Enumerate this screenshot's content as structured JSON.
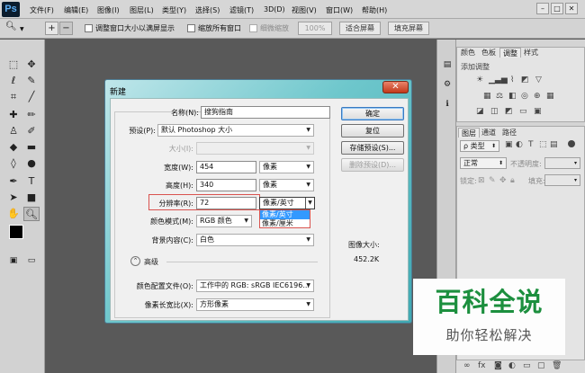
{
  "app": {
    "logo": "Ps"
  },
  "menubar": {
    "items": [
      "文件(F)",
      "编辑(E)",
      "图像(I)",
      "图层(L)",
      "类型(Y)",
      "选择(S)",
      "滤镜(T)",
      "3D(D)",
      "视图(V)",
      "窗口(W)",
      "帮助(H)"
    ],
    "window_buttons": [
      "–",
      "□",
      "✕"
    ]
  },
  "options_bar": {
    "resize_windows_label": "调整窗口大小以满屏显示",
    "zoom_all_label": "缩放所有窗口",
    "scrubby_zoom_label": "细微缩放",
    "zoom_value": "100%",
    "fit_screen_button": "适合屏幕",
    "fill_screen_button": "填充屏幕"
  },
  "panels": {
    "top_tabs": [
      "颜色",
      "色板",
      "调整",
      "样式"
    ],
    "adjust_title": "添加调整",
    "layers_tabs": [
      "图层",
      "通道",
      "路径"
    ],
    "kind_filter": "ρ 类型",
    "blend_mode": "正常",
    "opacity_label": "不透明度:",
    "lock_label": "锁定:",
    "fill_label": "填充:"
  },
  "dialog": {
    "title": "新建",
    "close": "✕",
    "name_label": "名称(N):",
    "name_value": "搜狗指南",
    "preset_label": "预设(P):",
    "preset_value": "默认 Photoshop 大小",
    "size_label": "大小(I):",
    "width_label": "宽度(W):",
    "width_value": "454",
    "width_unit": "像素",
    "height_label": "高度(H):",
    "height_value": "340",
    "height_unit": "像素",
    "resolution_label": "分辨率(R):",
    "resolution_value": "72",
    "resolution_unit": "像素/英寸",
    "resolution_options": [
      "像素/英寸",
      "像素/厘米"
    ],
    "color_mode_label": "颜色模式(M):",
    "color_mode_value": "RGB 颜色",
    "bg_label": "背景内容(C):",
    "bg_value": "白色",
    "advanced_label": "高级",
    "advanced_icon": "⌃",
    "color_profile_label": "颜色配置文件(O):",
    "color_profile_value": "工作中的 RGB: sRGB IEC6196...",
    "aspect_label": "像素长宽比(X):",
    "aspect_value": "方形像素",
    "buttons": {
      "ok": "确定",
      "reset": "复位",
      "save_preset": "存储预设(S)...",
      "delete_preset": "删除预设(D)..."
    },
    "image_size_label": "图像大小:",
    "image_size_value": "452.2K"
  },
  "watermark": {
    "title": "百科全说",
    "subtitle": "助你轻松解决"
  },
  "colors": {
    "accent": "#3a7ac0",
    "dialog_teal": "#3fa9b2",
    "highlight_red": "#d9534f",
    "watermark_green": "#1c8f3e"
  }
}
